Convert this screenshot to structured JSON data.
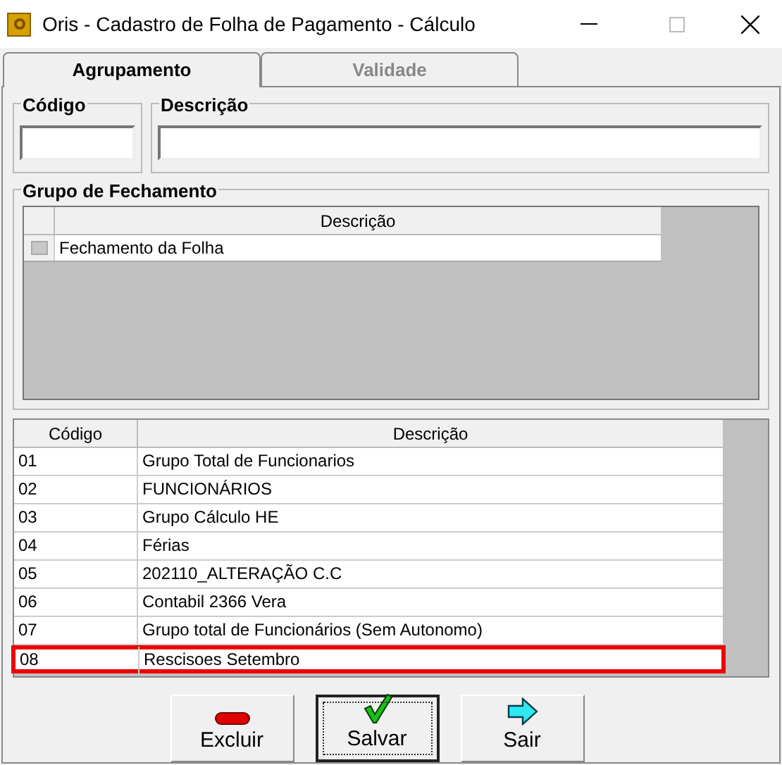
{
  "window": {
    "title": "Oris - Cadastro de Folha de Pagamento - Cálculo"
  },
  "tabs": [
    {
      "label": "Agrupamento",
      "selected": true
    },
    {
      "label": "Validade",
      "selected": false
    }
  ],
  "fields": [
    {
      "label": "Código"
    },
    {
      "label": "Descrição"
    }
  ],
  "closing_group": {
    "title": "Grupo de Fechamento",
    "columns": [
      "Descrição"
    ],
    "rows": [
      {
        "checked": false,
        "description": "Fechamento da Folha"
      }
    ]
  },
  "table": {
    "columns": [
      "Código",
      "Descrição"
    ],
    "rows": [
      {
        "code": "01",
        "description": "Grupo Total de Funcionarios",
        "highlighted": false
      },
      {
        "code": "02",
        "description": "FUNCIONÁRIOS",
        "highlighted": false
      },
      {
        "code": "03",
        "description": "Grupo Cálculo HE",
        "highlighted": false
      },
      {
        "code": "04",
        "description": "Férias",
        "highlighted": false
      },
      {
        "code": "05",
        "description": "202110_ALTERAÇÃO C.C",
        "highlighted": false
      },
      {
        "code": "06",
        "description": "Contabil 2366 Vera",
        "highlighted": false
      },
      {
        "code": "07",
        "description": "Grupo total de Funcionários (Sem Autonomo)",
        "highlighted": false
      },
      {
        "code": "08",
        "description": "Rescisoes Setembro",
        "highlighted": true
      }
    ]
  },
  "buttons": [
    {
      "kind": "delete",
      "label": "Excluir",
      "focused": false
    },
    {
      "kind": "save",
      "label": "Salvar",
      "focused": true
    },
    {
      "kind": "exit",
      "label": "Sair",
      "focused": false
    }
  ]
}
